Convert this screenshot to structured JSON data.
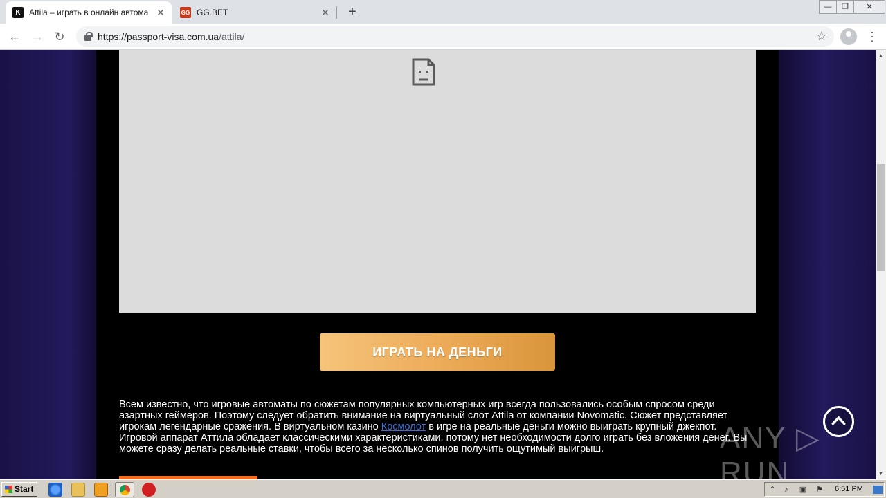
{
  "browser": {
    "tabs": [
      {
        "title": "Attila – играть в онлайн автомат с",
        "favicon": "K",
        "favicon_color": "#111111",
        "active": true
      },
      {
        "title": "GG.BET",
        "favicon": "GG",
        "favicon_color": "#c43b1d",
        "active": false
      }
    ],
    "address": {
      "host": "https://passport-visa.com.ua",
      "path": "/attila/"
    }
  },
  "page": {
    "play_button_label": "ИГРАТЬ НА ДЕНЬГИ",
    "article": {
      "text_before_link": "Всем известно, что игровые автоматы по сюжетам популярных компьютерных игр всегда пользовались особым спросом среди азартных геймеров. Поэтому следует обратить внимание на виртуальный слот Attila от компании Novomatic. Сюжет представляет игрокам легендарные сражения. В виртуальном казино ",
      "link": "Космолот",
      "text_after_link": " в игре на реальные деньги можно выиграть крупный джекпот. Игровой аппарат Аттила обладает классическими характеристиками, потому нет необходимости долго играть без вложения денег. Вы можете сразу делать реальные ставки, чтобы всего за несколько спинов получить ощутимый выигрыш."
    },
    "accent_color": "#edac5a"
  },
  "taskbar": {
    "start_label": "Start",
    "clock": "6:51 PM"
  }
}
